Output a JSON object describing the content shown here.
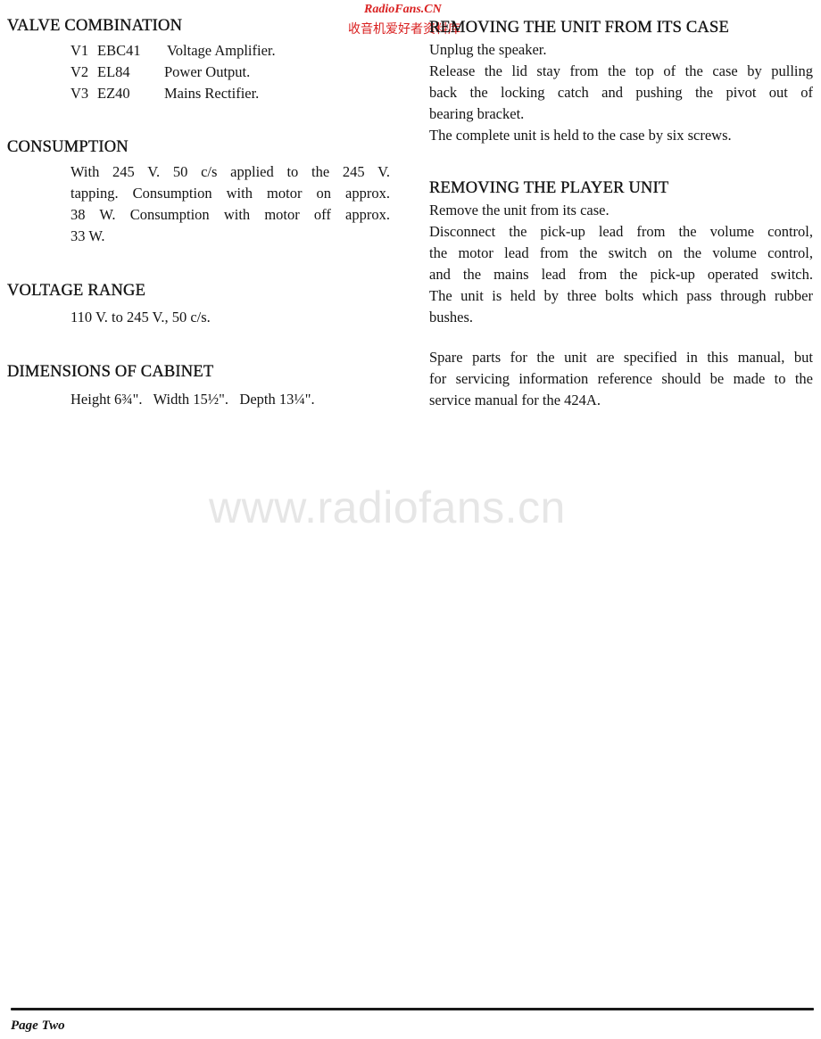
{
  "watermark": {
    "site_en": "RadioFans.CN",
    "site_cn": "收音机爱好者资料库",
    "url": "www.radiofans.cn",
    "accent_color": "#d92020"
  },
  "left": {
    "valve_combination": {
      "title": "VALVE COMBINATION",
      "valves": [
        {
          "id": "V1",
          "type": "EBC41",
          "function": "Voltage Amplifier."
        },
        {
          "id": "V2",
          "type": "EL84",
          "function": "Power Output."
        },
        {
          "id": "V3",
          "type": "EZ40",
          "function": "Mains Rectifier."
        }
      ]
    },
    "consumption": {
      "title": "CONSUMPTION",
      "lines": [
        "With 245 V. 50 c/s applied to the 245 V.",
        "tapping. Consumption with motor on approx.",
        "38 W. Consumption with motor off approx.",
        "33 W."
      ]
    },
    "voltage_range": {
      "title": "VOLTAGE RANGE",
      "text": "110 V. to 245 V., 50 c/s."
    },
    "dimensions": {
      "title": "DIMENSIONS OF CABINET",
      "text": "Height 6¾\".   Width 15½\".   Depth 13¼\"."
    }
  },
  "right": {
    "removing_case": {
      "title": "REMOVING THE UNIT FROM ITS CASE",
      "lines": [
        "Unplug the speaker.",
        "Release the lid stay from the top of the case by pulling",
        "back the locking catch and pushing the pivot out of",
        "bearing bracket.",
        "The complete unit is held to the case by six screws."
      ]
    },
    "removing_player": {
      "title": "REMOVING THE PLAYER UNIT",
      "lines": [
        "Remove the unit from its case.",
        "Disconnect the pick-up lead from the volume control,",
        "the motor lead from the switch on the volume control,",
        "and the mains lead from the pick-up operated switch.",
        "The unit is held by three bolts which pass through rubber",
        "bushes."
      ]
    },
    "spare_parts": {
      "lines": [
        "Spare parts for the unit are specified in this manual, but",
        "for servicing information reference should be made to the",
        "service manual for the 424A."
      ]
    }
  },
  "footer": {
    "page_label": "Page Two"
  }
}
